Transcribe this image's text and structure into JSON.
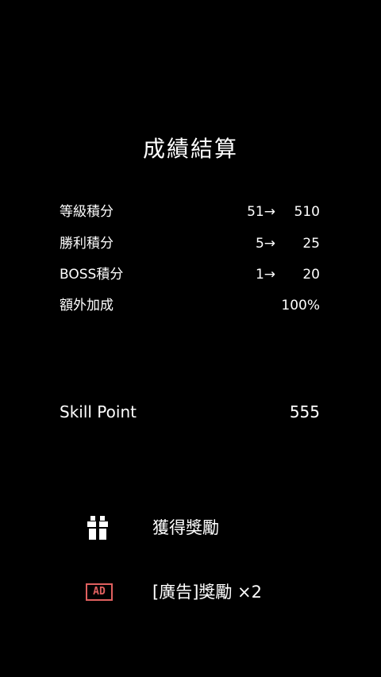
{
  "title": "成績結算",
  "score_rows": [
    {
      "label": "等級積分",
      "from": "51→",
      "total": "510"
    },
    {
      "label": "勝利積分",
      "from": "5→",
      "total": "25"
    },
    {
      "label": "BOSS積分",
      "from": "1→",
      "total": "20"
    },
    {
      "label": "額外加成",
      "from": "",
      "total": "100%"
    }
  ],
  "skill_point": {
    "label": "Skill Point",
    "value": "555"
  },
  "actions": {
    "claim": {
      "label": "獲得獎勵",
      "icon": "gift-icon"
    },
    "ad_double": {
      "label": "[廣告]獎勵 ×2",
      "icon": "ad-icon",
      "badge": "AD"
    }
  },
  "colors": {
    "background": "#000000",
    "text": "#ffffff",
    "ad_accent": "#e0605f"
  }
}
